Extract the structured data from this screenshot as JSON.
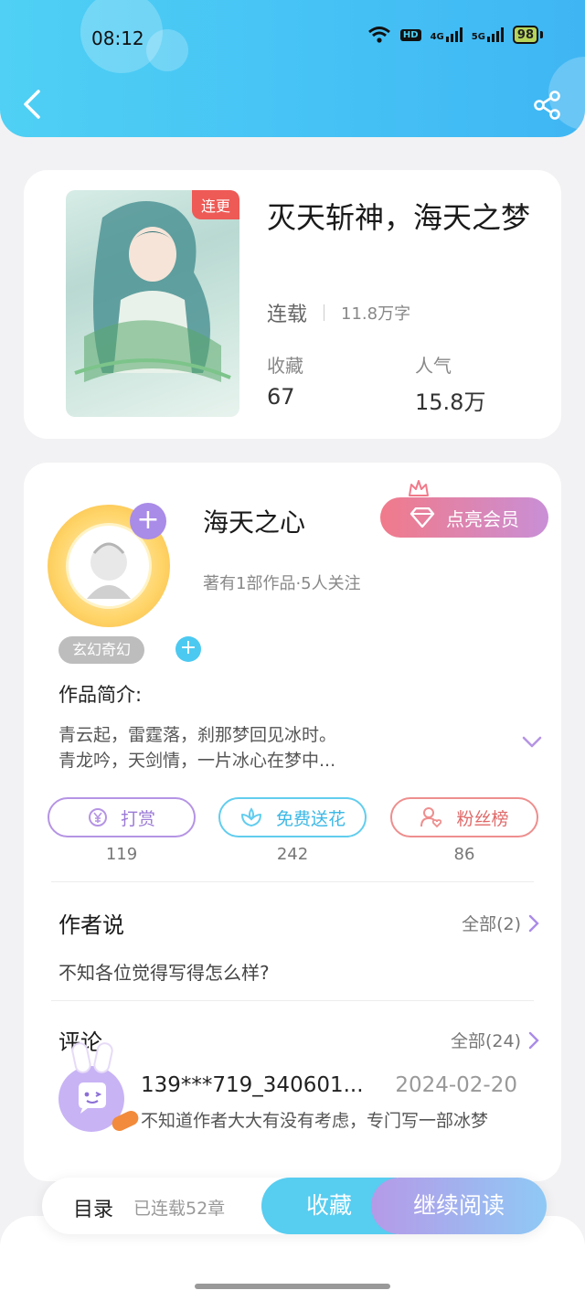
{
  "status_bar": {
    "time": "08:12",
    "hd_label": "HD",
    "net1": "4G",
    "net2": "5G",
    "battery": "98"
  },
  "book": {
    "title": "灭天斩神，海天之梦",
    "cover_tag": "连更",
    "status": "连载",
    "word_count": "11.8万字",
    "favorites_label": "收藏",
    "favorites_value": "67",
    "popularity_label": "人气",
    "popularity_value": "15.8万"
  },
  "author": {
    "name": "海天之心",
    "meta": "著有1部作品·5人关注",
    "vip_button": "点亮会员",
    "genre_tag": "玄幻奇幻"
  },
  "intro": {
    "label": "作品简介:",
    "line1": "青云起，雷霆落，刹那梦回见冰时。",
    "line2": "青龙吟，天剑情，一片冰心在梦中..."
  },
  "actions": [
    {
      "label": "打赏",
      "count": "119"
    },
    {
      "label": "免费送花",
      "count": "242"
    },
    {
      "label": "粉丝榜",
      "count": "86"
    }
  ],
  "author_says": {
    "title": "作者说",
    "more": "全部(2)",
    "text": "不知各位觉得写得怎么样?"
  },
  "comments": {
    "title": "评论",
    "more": "全部(24)",
    "user": "139***719_340601...",
    "date": "2024-02-20",
    "text": "不知道作者大大有没有考虑，专门写一部冰梦"
  },
  "bottom_bar": {
    "toc": "目录",
    "chapters": "已连载52章",
    "favorite": "收藏",
    "continue": "继续阅读"
  },
  "colors": {
    "header": "#46c2f5",
    "vip_start": "#f17a8a",
    "vip_end": "#c98fd6",
    "fav_button": "#57cdf0",
    "cover_tag": "#ee5a56"
  }
}
